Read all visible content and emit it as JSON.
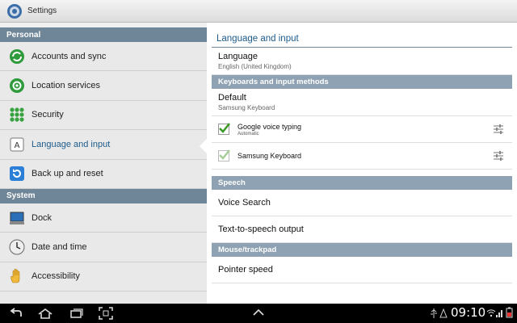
{
  "app": {
    "title": "Settings"
  },
  "left": {
    "sections": [
      {
        "label": "Personal"
      },
      {
        "label": "System"
      }
    ],
    "items": [
      {
        "label": "Accounts and sync",
        "icon": "sync-icon"
      },
      {
        "label": "Location services",
        "icon": "location-icon"
      },
      {
        "label": "Security",
        "icon": "security-icon"
      },
      {
        "label": "Language and input",
        "icon": "language-icon",
        "active": true
      },
      {
        "label": "Back up and reset",
        "icon": "backup-icon"
      },
      {
        "label": "Dock",
        "icon": "dock-icon"
      },
      {
        "label": "Date and time",
        "icon": "clock-icon"
      },
      {
        "label": "Accessibility",
        "icon": "hand-icon"
      }
    ]
  },
  "right": {
    "heading": "Language and input",
    "language": {
      "title": "Language",
      "summary": "English (United Kingdom)"
    },
    "sec_keyboards": "Keyboards and input methods",
    "default": {
      "title": "Default",
      "summary": "Samsung Keyboard"
    },
    "google_voice": {
      "title": "Google voice typing",
      "summary": "Automatic",
      "checked": true
    },
    "samsung_kb": {
      "title": "Samsung Keyboard",
      "checked": true
    },
    "sec_speech": "Speech",
    "voice_search": "Voice Search",
    "tts": "Text-to-speech output",
    "sec_mouse": "Mouse/trackpad",
    "pointer_speed": "Pointer speed"
  },
  "statusbar": {
    "time": "09:10"
  },
  "colors": {
    "accent": "#1d5b8a",
    "section_bg": "#6f8598",
    "right_section_bg": "#8ea2b3"
  }
}
